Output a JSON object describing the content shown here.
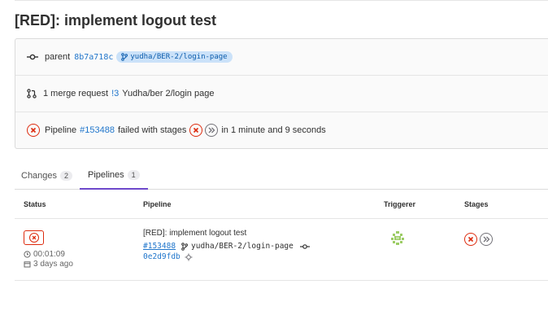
{
  "title": "[RED]: implement logout test",
  "info": {
    "parent_label": "parent",
    "parent_sha": "8b7a718c",
    "parent_branch": "yudha/BER-2/login-page",
    "mr_text": "1 merge request",
    "mr_ref": "!3",
    "mr_title": "Yudha/ber 2/login page",
    "pipeline_label": "Pipeline",
    "pipeline_id": "#153488",
    "pipeline_status_text": "failed with stages",
    "pipeline_duration_text": "in 1 minute and 9 seconds"
  },
  "tabs": [
    {
      "label": "Changes",
      "count": "2"
    },
    {
      "label": "Pipelines",
      "count": "1"
    }
  ],
  "table": {
    "headers": [
      "Status",
      "Pipeline",
      "Triggerer",
      "Stages"
    ],
    "row": {
      "duration": "00:01:09",
      "finished": "3 days ago",
      "commit_title": "[RED]: implement logout test",
      "pipeline_id": "#153488",
      "branch": "yudha/BER-2/login-page",
      "sha": "0e2d9fdb"
    }
  },
  "colors": {
    "failed": "#dd2b0e",
    "link": "#1f75cb",
    "accent": "#6e49cb",
    "branch_bg": "#cbe2f9"
  },
  "icons": {
    "commit": "commit-icon",
    "branch": "branch-icon",
    "merge_request": "merge-request-icon",
    "failed": "status-failed-icon",
    "skipped": "status-skipped-icon",
    "clock": "clock-icon",
    "calendar": "calendar-icon"
  }
}
